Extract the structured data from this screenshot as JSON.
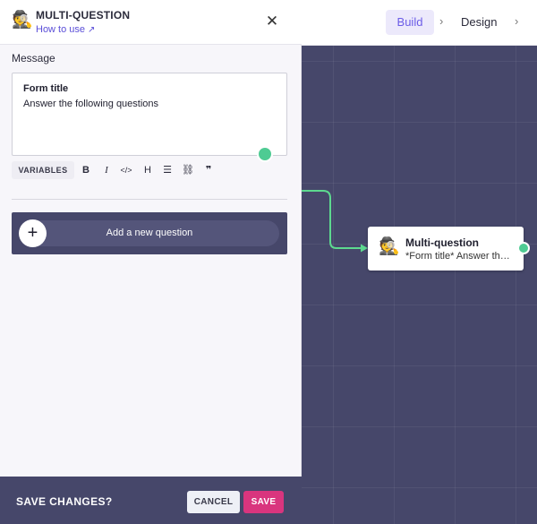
{
  "header": {
    "icon": "detective-emoji",
    "title": "MULTI-QUESTION",
    "how_to_use": "How to use",
    "how_to_use_icon": "external-link-icon",
    "close_icon": "close-icon"
  },
  "message": {
    "label": "Message",
    "title": "Form title",
    "body": "Answer the following questions"
  },
  "toolbar": {
    "variables": "VARIABLES",
    "bold": "B",
    "italic": "I",
    "code": "</>",
    "heading": "H",
    "list": "☰",
    "link": "⛓",
    "quote": "❞"
  },
  "add_question": {
    "label": "Add a new question",
    "plus": "+"
  },
  "footer": {
    "prompt": "SAVE CHANGES?",
    "cancel": "CANCEL",
    "save": "SAVE"
  },
  "breadcrumb": {
    "build": "Build",
    "design": "Design",
    "separator": "›"
  },
  "node": {
    "title": "Multi-question",
    "subtitle": "*Form title* Answer the following questions"
  },
  "colors": {
    "canvas": "#46476a",
    "accent": "#5b4fd8",
    "save": "#d9357e",
    "connector": "#5dd98f"
  }
}
